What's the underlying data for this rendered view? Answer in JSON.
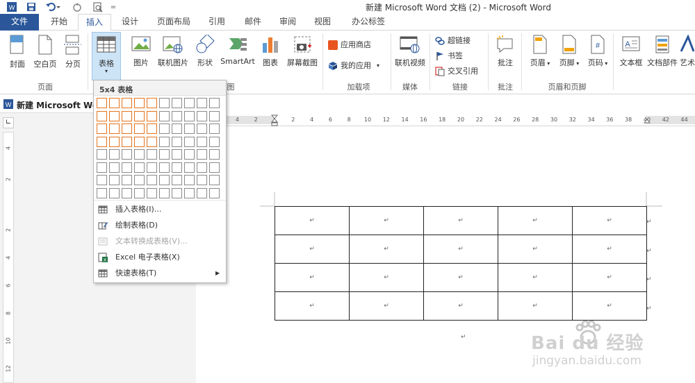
{
  "window": {
    "title": "新建 Microsoft Word 文档 (2) - Microsoft Word"
  },
  "quick_access": {
    "save_icon": "save-icon",
    "undo_icon": "undo-icon",
    "redo_icon": "redo-icon",
    "preview_icon": "print-preview-icon",
    "customize": "="
  },
  "tabs": [
    {
      "label": "文件"
    },
    {
      "label": "开始"
    },
    {
      "label": "插入"
    },
    {
      "label": "设计"
    },
    {
      "label": "页面布局"
    },
    {
      "label": "引用"
    },
    {
      "label": "邮件"
    },
    {
      "label": "审阅"
    },
    {
      "label": "视图"
    },
    {
      "label": "办公标签"
    }
  ],
  "ribbon": {
    "cover": "封面",
    "blank_page": "空白页",
    "page_break": "分页",
    "table": "表格",
    "picture": "图片",
    "online_picture": "联机图片",
    "shapes": "形状",
    "smartart": "SmartArt",
    "chart": "图表",
    "screenshot": "屏幕截图",
    "store": "应用商店",
    "my_apps": "我的应用",
    "online_video": "联机视频",
    "hyperlink": "超链接",
    "bookmark": "书签",
    "cross_ref": "交叉引用",
    "comment": "批注",
    "header": "页眉",
    "footer": "页脚",
    "page_number": "页码",
    "textbox": "文本框",
    "quick_parts": "文档部件",
    "wordart": "艺术",
    "groups": {
      "pages": "页面",
      "illustrations_tail": "图",
      "addins": "加载项",
      "media": "媒体",
      "links": "链接",
      "comments": "批注",
      "header_footer": "页眉和页脚"
    }
  },
  "document_tab": {
    "label": "新建 Microsoft Wo"
  },
  "ruler": {
    "left_numbers": [
      "4",
      "2"
    ],
    "right_numbers": [
      "2",
      "4",
      "6",
      "8",
      "10",
      "12",
      "14",
      "16",
      "18",
      "20",
      "22",
      "24",
      "26",
      "28",
      "30",
      "32",
      "34",
      "36",
      "38",
      "40",
      "42",
      "44"
    ],
    "vertical_numbers": [
      "4",
      "2",
      "2",
      "4",
      "6",
      "8",
      "10",
      "12"
    ]
  },
  "table_menu": {
    "grid_title": "5x4 表格",
    "selected_cols": 5,
    "selected_rows": 4,
    "grid_cols": 10,
    "grid_rows": 8,
    "items": [
      {
        "label": "插入表格(I)...",
        "enabled": true
      },
      {
        "label": "绘制表格(D)",
        "enabled": true
      },
      {
        "label": "文本转换成表格(V)...",
        "enabled": false
      },
      {
        "label": "Excel 电子表格(X)",
        "enabled": true
      },
      {
        "label": "快速表格(T)",
        "enabled": true
      }
    ]
  },
  "document": {
    "table_rows": 4,
    "table_cols": 5,
    "cell_mark": "↵",
    "para_mark": "↵"
  },
  "watermark": {
    "logo": "Bai du 经验",
    "url": "jingyan.baidu.com"
  }
}
